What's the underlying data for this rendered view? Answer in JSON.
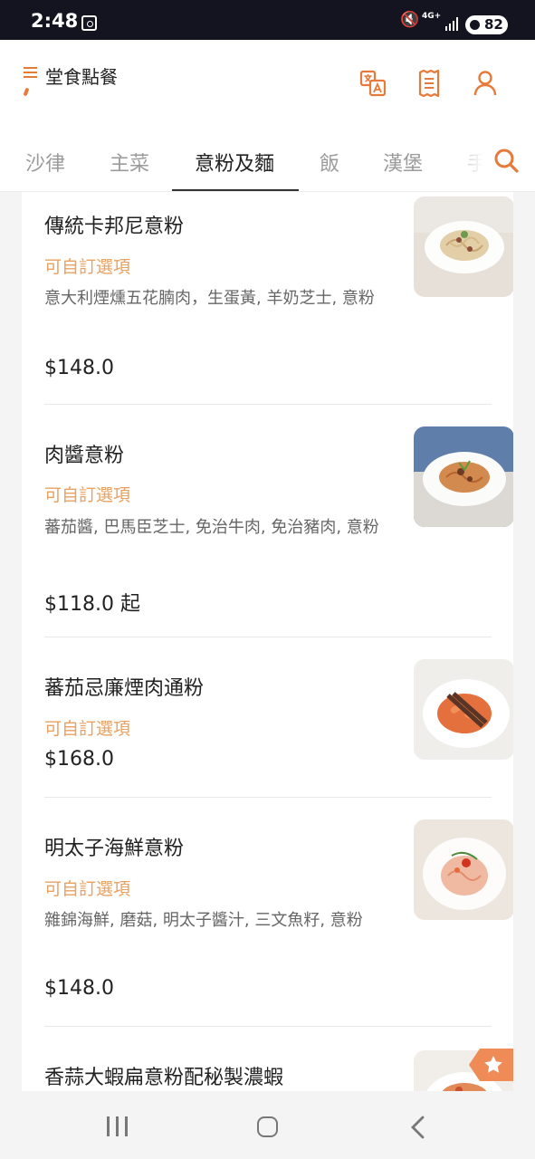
{
  "status_bar": {
    "time": "2:48",
    "network": "4G+",
    "battery": "82"
  },
  "header": {
    "title": "堂食點餐"
  },
  "tabs": [
    {
      "label": "沙律",
      "active": false
    },
    {
      "label": "主菜",
      "active": false
    },
    {
      "label": "意粉及麵",
      "active": true
    },
    {
      "label": "飯",
      "active": false
    },
    {
      "label": "漢堡",
      "active": false
    },
    {
      "label": "手",
      "active": false
    }
  ],
  "menu_items": [
    {
      "name": "傳統卡邦尼意粉",
      "option": "可自訂選項",
      "description": "意大利煙燻五花腩肉，生蛋黃, 羊奶芝士, 意粉",
      "price": "$148.0"
    },
    {
      "name": "肉醬意粉",
      "option": "可自訂選項",
      "description": "蕃茄醬, 巴馬臣芝士, 免治牛肉, 免治豬肉, 意粉",
      "price": "$118.0 起"
    },
    {
      "name": "蕃茄忌廉煙肉通粉",
      "option": "可自訂選項",
      "description": "",
      "price": "$168.0"
    },
    {
      "name": "明太子海鮮意粉",
      "option": "可自訂選項",
      "description": "雜錦海鮮, 磨菇, 明太子醬汁, 三文魚籽, 意粉",
      "price": "$148.0"
    },
    {
      "name": "香蒜大蝦扁意粉配秘製濃蝦",
      "option": "",
      "description": "",
      "price": ""
    }
  ],
  "icons": {
    "menu": "hamburger-icon",
    "translate": "translate-icon",
    "receipt": "receipt-icon",
    "account": "person-icon",
    "search": "search-icon",
    "favorite": "star-icon"
  },
  "colors": {
    "accent": "#e57a3a",
    "option_text": "#e8a160",
    "active_tab_indicator": "#333333"
  }
}
